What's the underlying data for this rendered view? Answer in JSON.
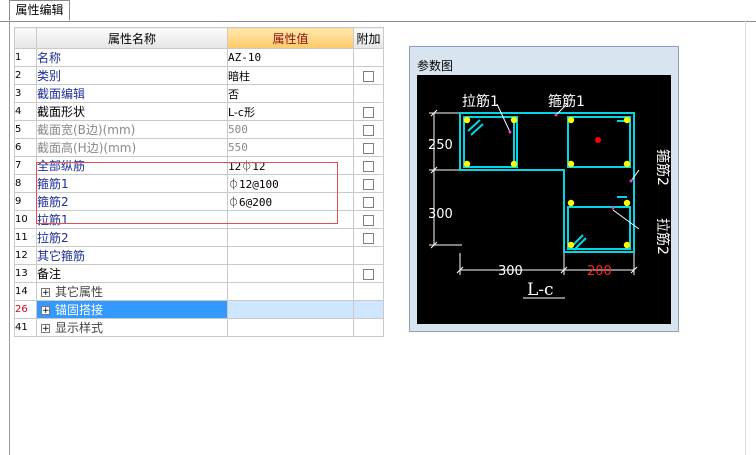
{
  "tab": {
    "label": "属性编辑"
  },
  "table": {
    "headers": {
      "name": "属性名称",
      "value": "属性值",
      "extra": "附加"
    },
    "rows": [
      {
        "num": "1",
        "name": "名称",
        "value": "AZ-10",
        "checkbox": false,
        "style": "link"
      },
      {
        "num": "2",
        "name": "类别",
        "value": "暗柱",
        "checkbox": true,
        "style": "link"
      },
      {
        "num": "3",
        "name": "截面编辑",
        "value": "否",
        "checkbox": false,
        "style": "link"
      },
      {
        "num": "4",
        "name": "截面形状",
        "value": "L-c形",
        "checkbox": true,
        "style": "black"
      },
      {
        "num": "5",
        "name": "截面宽(B边)(mm)",
        "value": "500",
        "checkbox": true,
        "style": "disabled"
      },
      {
        "num": "6",
        "name": "截面高(H边)(mm)",
        "value": "550",
        "checkbox": true,
        "style": "disabled"
      },
      {
        "num": "7",
        "name": "全部纵筋",
        "value": "12⏀12",
        "checkbox": true,
        "style": "link"
      },
      {
        "num": "8",
        "name": "箍筋1",
        "value": "⏀12@100",
        "checkbox": true,
        "style": "link"
      },
      {
        "num": "9",
        "name": "箍筋2",
        "value": "⏀6@200",
        "checkbox": true,
        "style": "link"
      },
      {
        "num": "10",
        "name": "拉筋1",
        "value": "",
        "checkbox": true,
        "style": "link"
      },
      {
        "num": "11",
        "name": "拉筋2",
        "value": "",
        "checkbox": true,
        "style": "link"
      },
      {
        "num": "12",
        "name": "其它箍筋",
        "value": "",
        "checkbox": false,
        "style": "link"
      },
      {
        "num": "13",
        "name": "备注",
        "value": "",
        "checkbox": true,
        "style": "black"
      },
      {
        "num": "14",
        "name": "其它属性",
        "value": "",
        "checkbox": false,
        "style": "group"
      },
      {
        "num": "26",
        "name": "锚固搭接",
        "value": "",
        "checkbox": false,
        "style": "selected"
      },
      {
        "num": "41",
        "name": "显示样式",
        "value": "",
        "checkbox": false,
        "style": "group"
      }
    ]
  },
  "diagram": {
    "title": "参数图",
    "labels": {
      "tie1": "拉筋1",
      "stirrup1": "箍筋1",
      "stirrup2": "箍筋2",
      "tie2": "拉筋2",
      "dim_250": "250",
      "dim_300_v": "300",
      "dim_300_h": "300",
      "dim_200": "200",
      "shape": "L-c"
    },
    "colors": {
      "rebar": "#00d7e6",
      "bar_dot": "#ffff00",
      "dim": "#ffffff",
      "highlight": "#ff0000",
      "tie": "#ff33cc"
    }
  }
}
